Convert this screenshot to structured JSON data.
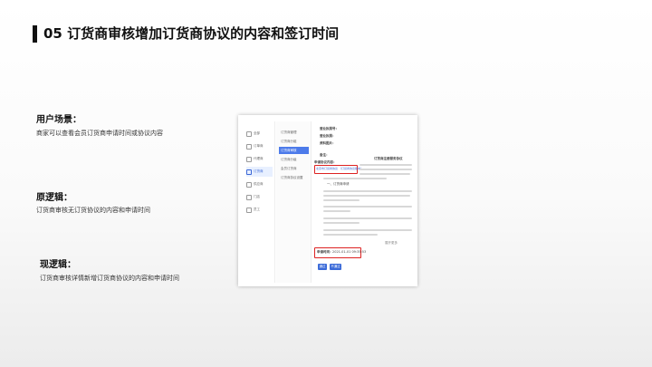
{
  "title": "05 订货商审核增加订货商协议的内容和签订时间",
  "sections": {
    "scenario": {
      "heading": "用户场景：",
      "text": "商家可以查看会员订货商申请时间或协议内容"
    },
    "old_logic": {
      "heading": "原逻辑：",
      "text": "订货商审核无订货协议的内容和申请时间"
    },
    "new_logic": {
      "heading": "现逻辑：",
      "text": "订货商审核详情新增订货商协议的内容和申请时间"
    }
  },
  "screenshot": {
    "nav_primary": [
      {
        "label": "全部",
        "active": false
      },
      {
        "label": "订单商",
        "active": false
      },
      {
        "label": "代理商",
        "active": false
      },
      {
        "label": "订货商",
        "active": true
      },
      {
        "label": "供应商",
        "active": false
      },
      {
        "label": "门店",
        "active": false
      },
      {
        "label": "员工",
        "active": false
      }
    ],
    "nav_secondary": [
      {
        "label": "订货商管理",
        "active": false
      },
      {
        "label": "订货商分组",
        "active": false
      },
      {
        "label": "订货商审核",
        "active": true
      },
      {
        "label": "订货商分级",
        "active": false
      },
      {
        "label": "会员订货商",
        "active": false
      },
      {
        "label": "订货商协议设置",
        "active": false
      }
    ],
    "fields": [
      {
        "label": "营业执照号："
      },
      {
        "label": "营业执照："
      },
      {
        "label": "资料图片："
      },
      {
        "label": "备注："
      }
    ],
    "agreement_label": "申请协议内容：",
    "agreement_value": "北京市订货商协议 （订货商协议版本）",
    "agreement_title": "订货商注册服务协议",
    "section_label": "一、订货商申请",
    "more_label": "展开更多",
    "apply_time_label": "申请时间：",
    "apply_time_value": "2021-01-01 09:35:53",
    "btn_pass": "通过",
    "btn_reject": "不通过"
  }
}
